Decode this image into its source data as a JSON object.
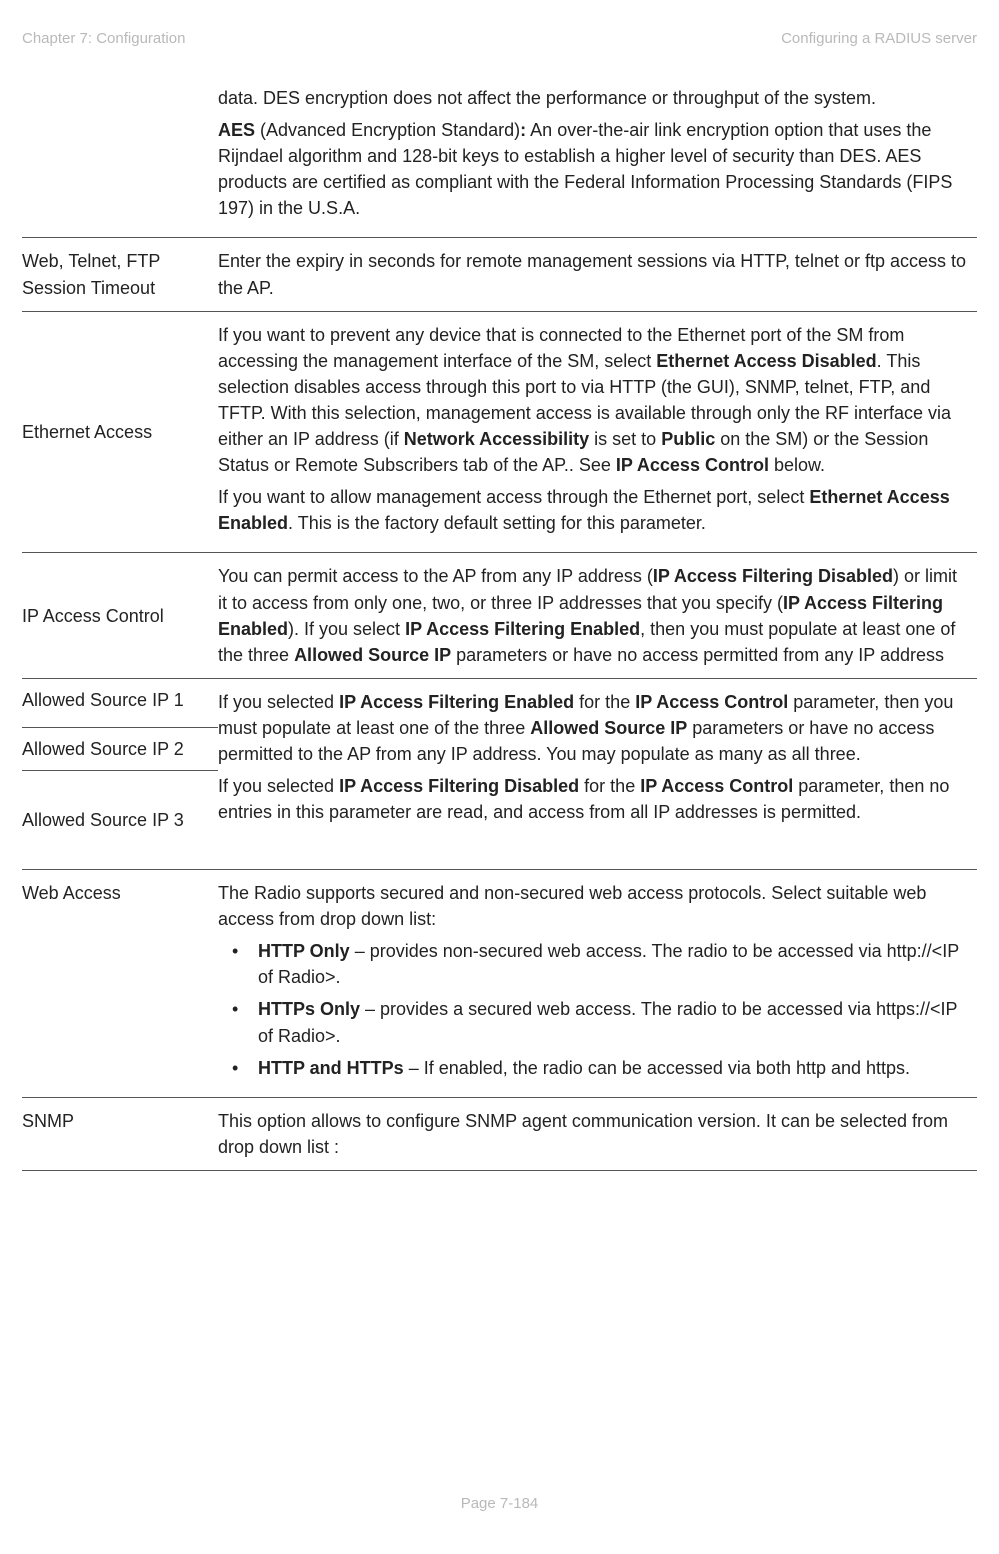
{
  "header": {
    "left": "Chapter 7:  Configuration",
    "right": "Configuring a RADIUS server"
  },
  "rows": {
    "r0": {
      "p1": "data.  DES encryption does not affect the performance or throughput of the system.",
      "p2a": "AES",
      "p2b": " (Advanced Encryption Standard)",
      "p2c": ":",
      "p2d": " An over-the-air link encryption option that uses the Rijndael algorithm and 128-bit keys to establish a higher level of security than DES. AES products are certified as compliant with the Federal Information Processing Standards (FIPS 197) in the U.S.A."
    },
    "r1": {
      "label": "Web, Telnet, FTP Session Timeout",
      "desc": "Enter the expiry in seconds for remote management sessions via HTTP, telnet or ftp access to the AP."
    },
    "r2": {
      "label": "Ethernet Access",
      "p1a": "If you want to prevent any device that is connected to the Ethernet port of the SM from accessing the management interface of the SM, select ",
      "p1b": "Ethernet Access Disabled",
      "p1c": ". This selection disables access through this port to via HTTP (the GUI), SNMP, telnet, FTP, and TFTP. With this selection, management access is available through only the RF interface via either an IP address (if ",
      "p1d": "Network Accessibility",
      "p1e": " is set to ",
      "p1f": "Public",
      "p1g": " on the SM) or the Session Status or Remote Subscribers tab of the AP.. See ",
      "p1h": "IP Access Control",
      "p1i": " below.",
      "p2a": "If you want to allow management access through the Ethernet port, select ",
      "p2b": "Ethernet Access Enabled",
      "p2c": ". This is the factory default setting for this parameter."
    },
    "r3": {
      "label": "IP Access Control",
      "a": "You can permit access to the AP from any IP address (",
      "b": "IP Access Filtering Disabled",
      "c": ") or limit it to access from only one, two, or three IP addresses that you specify (",
      "d": "IP Access Filtering Enabled",
      "e": "). If you select ",
      "f": "IP Access Filtering Enabled",
      "g": ", then you must populate at least one of the three ",
      "h": "Allowed Source IP",
      "i": " parameters or have no access permitted from any IP address"
    },
    "r4": {
      "l1": "Allowed Source IP 1",
      "l2": "Allowed Source IP 2",
      "l3": "Allowed Source IP 3",
      "p1a": "If you selected ",
      "p1b": "IP Access Filtering Enabled",
      "p1c": " for the ",
      "p1d": "IP Access Control",
      "p1e": " parameter, then you must populate at least one of the three ",
      "p1f": "Allowed Source IP",
      "p1g": " parameters or have no access permitted to the AP from any IP address. You may populate as many as all three.",
      "p2a": "If you selected ",
      "p2b": "IP Access Filtering Disabled",
      "p2c": " for the ",
      "p2d": "IP Access Control",
      "p2e": " parameter, then no entries in this parameter are read, and access from all IP addresses is permitted."
    },
    "r5": {
      "label": "Web Access",
      "intro": "The Radio supports secured and non-secured web access protocols. Select suitable web access from drop down list:",
      "b1a": "HTTP Only",
      "b1b": " – provides non-secured web access. The radio to be accessed via http://<IP of Radio>.",
      "b2a": "HTTPs Only",
      "b2b": " – provides a secured web access. The radio to be accessed via https://<IP of Radio>.",
      "b3a": "HTTP and HTTPs",
      "b3b": " – If enabled, the radio can be accessed via both http and https."
    },
    "r6": {
      "label": "SNMP",
      "desc": "This option allows to configure SNMP agent communication version. It can be selected from drop down list :"
    }
  },
  "footer": "Page 7-184"
}
